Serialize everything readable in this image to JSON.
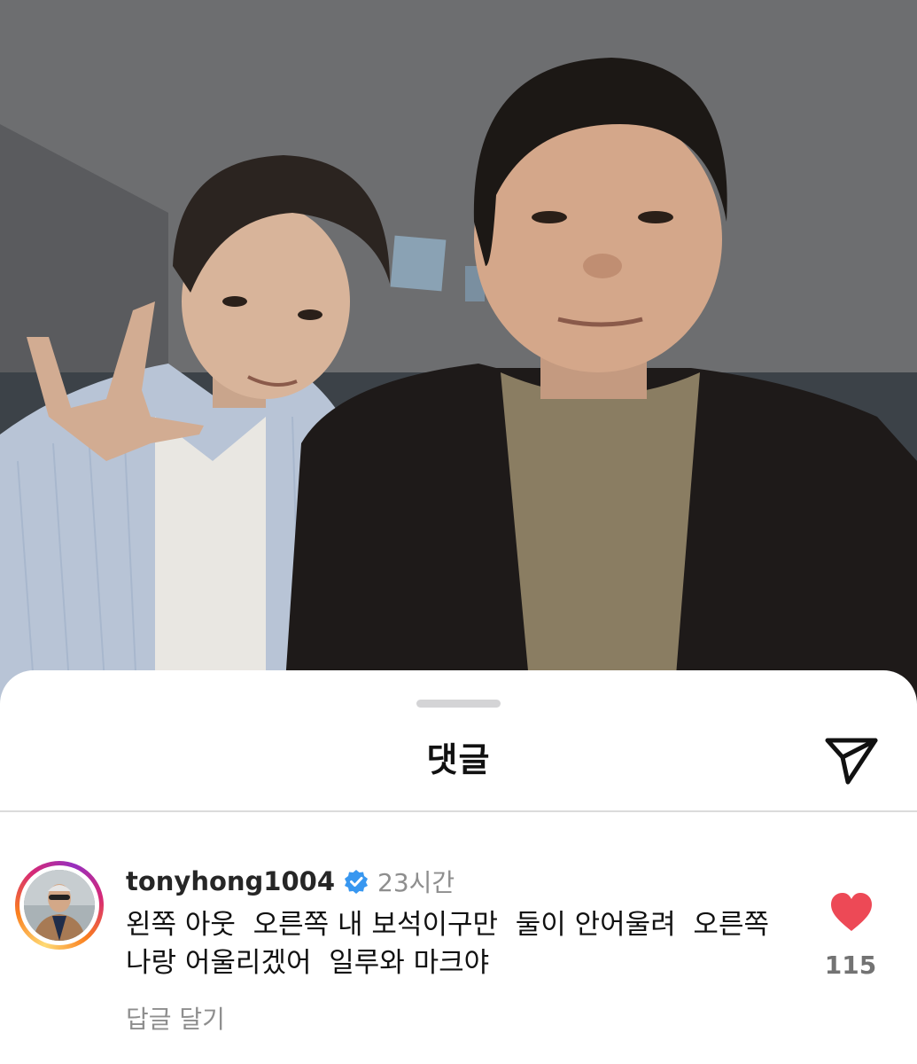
{
  "sheet": {
    "title": "댓글"
  },
  "comment": {
    "username": "tonyhong1004",
    "verified": true,
    "timestamp": "23시간",
    "text": "왼쪽 아웃  오른쪽 내 보석이구만  둘이 안어울려  오른쪽  나랑 어울리겠어  일루와 마크야",
    "reply_label": "답글 달기",
    "like_count": "115",
    "liked": true
  },
  "icons": {
    "share": "paper-plane-icon",
    "like": "heart-icon",
    "verified": "verified-badge-icon"
  },
  "colors": {
    "like": "#ed4956",
    "verified": "#3897f0",
    "muted_text": "#8e8e8e"
  }
}
